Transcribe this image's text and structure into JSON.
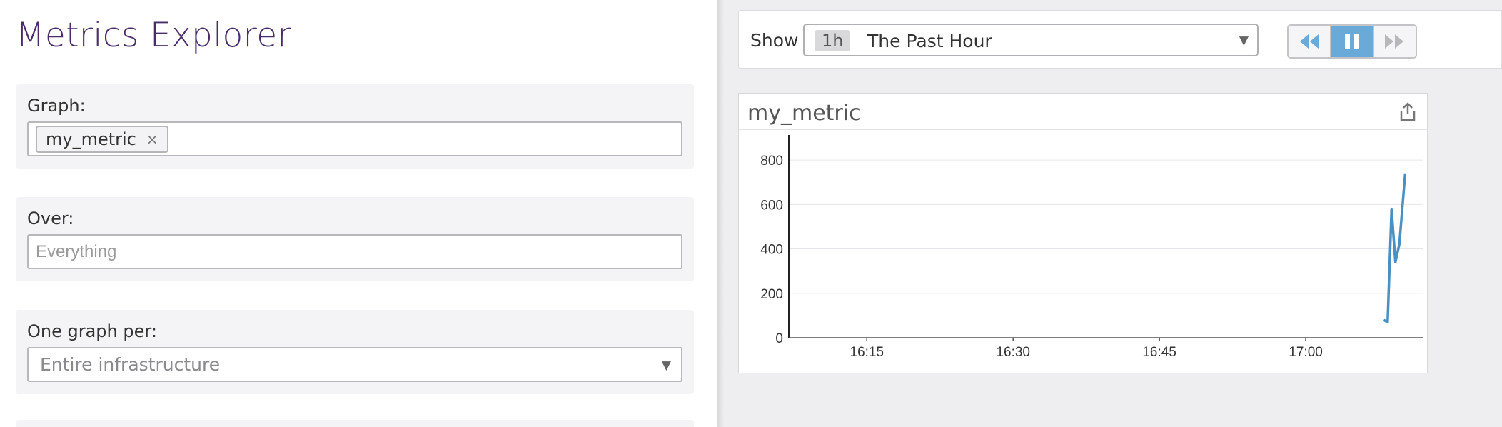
{
  "page": {
    "title": "Metrics Explorer"
  },
  "graph_section": {
    "label": "Graph:",
    "chips": [
      {
        "label": "my_metric",
        "remove_symbol": "×"
      }
    ]
  },
  "over_section": {
    "label": "Over:",
    "placeholder": "Everything"
  },
  "per_section": {
    "label": "One graph per:",
    "value": "Entire infrastructure",
    "caret": "▼"
  },
  "toolbar": {
    "show_label": "Show",
    "time_badge": "1h",
    "time_label": "The Past Hour",
    "caret": "▼",
    "buttons": [
      {
        "name": "rewind",
        "icon": "rewind-icon"
      },
      {
        "name": "pause",
        "icon": "pause-icon",
        "active": true
      },
      {
        "name": "fast-forward",
        "icon": "fast-forward-icon"
      }
    ],
    "colors": {
      "active": "#6aaad8",
      "icon": "#6aaad8"
    }
  },
  "graph_card": {
    "title": "my_metric",
    "icon": "share-icon"
  },
  "chart_data": {
    "type": "line",
    "xlabel": "",
    "ylabel": "",
    "ylim": [
      0,
      900
    ],
    "xlim": [
      "16:07",
      "17:12"
    ],
    "y_ticks": [
      0,
      200,
      400,
      600,
      800
    ],
    "x_ticks": [
      "16:15",
      "16:30",
      "16:45",
      "17:00"
    ],
    "grid": true,
    "series": [
      {
        "color": "#4a90c2",
        "x": [
          "17:08",
          "17:08.4",
          "17:08.8",
          "17:09.2",
          "17:09.6",
          "17:10.2"
        ],
        "y": [
          80,
          70,
          580,
          340,
          420,
          740
        ]
      }
    ]
  }
}
